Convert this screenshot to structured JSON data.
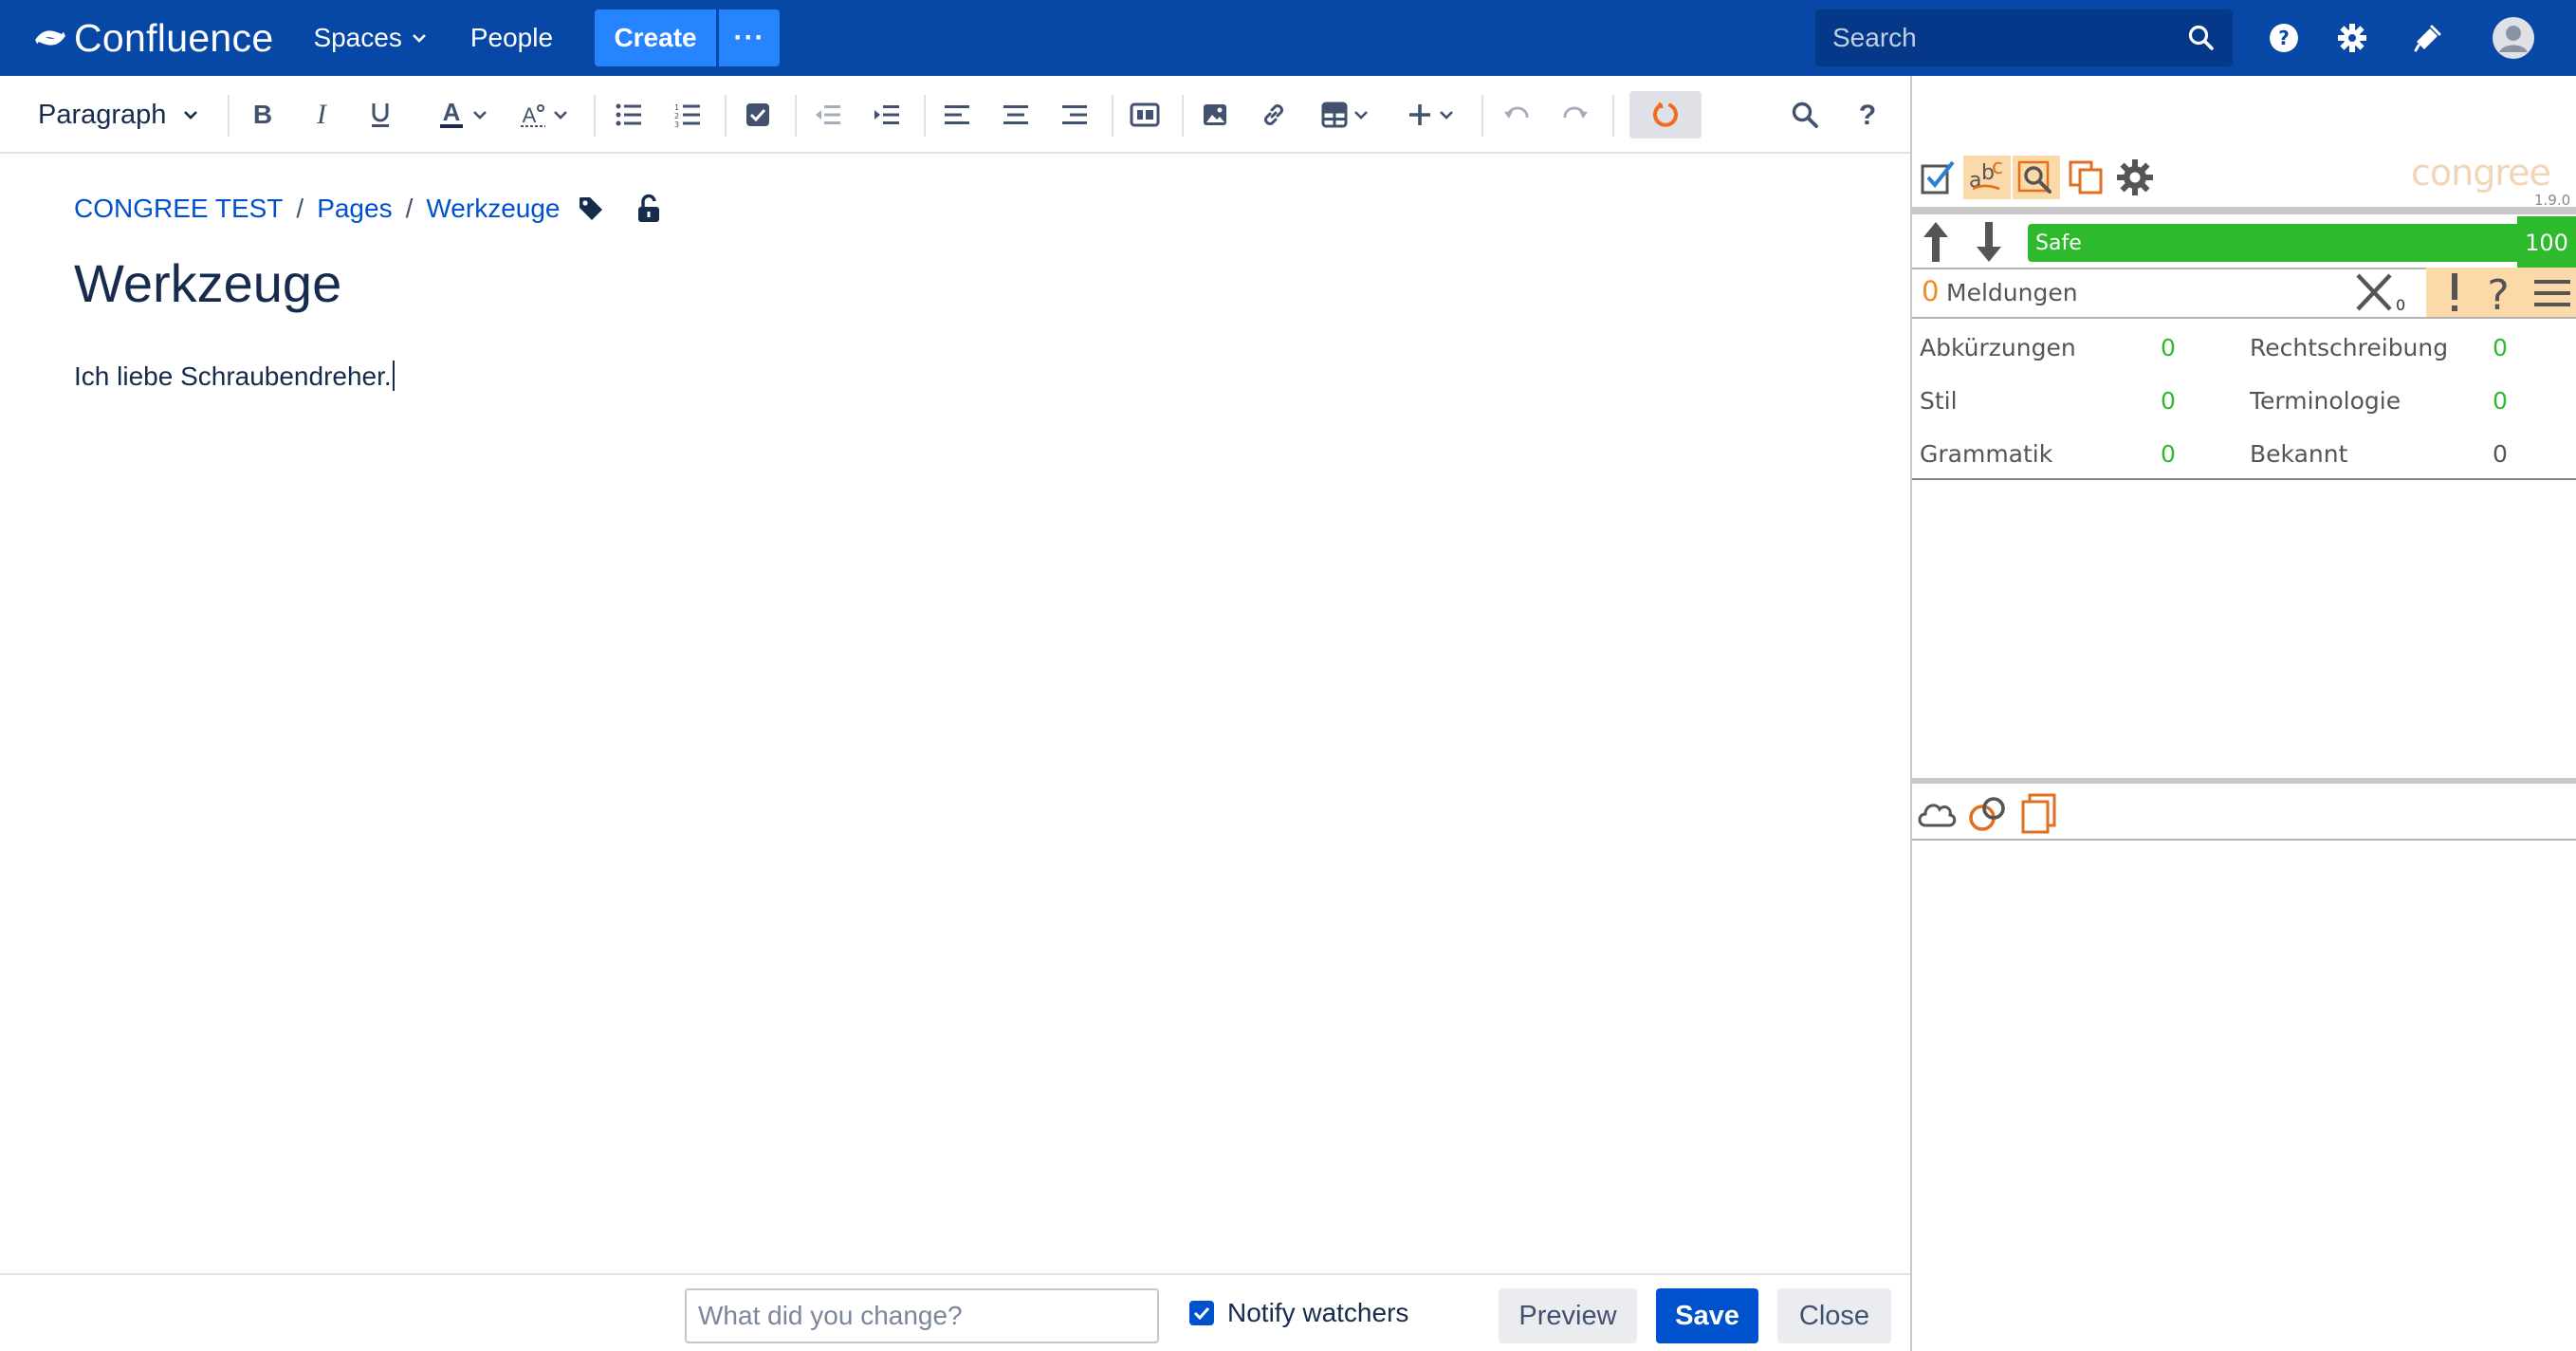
{
  "nav": {
    "logo_text": "Confluence",
    "spaces_label": "Spaces",
    "people_label": "People",
    "create_label": "Create",
    "more_label": "···",
    "search_placeholder": "Search",
    "brand_color": "#0747a6",
    "accent_color": "#2684ff"
  },
  "toolbar": {
    "style_select": "Paragraph",
    "icons": [
      "bold-icon",
      "italic-icon",
      "underline-icon",
      "text-color-icon",
      "text-style-icon",
      "bullet-list-icon",
      "numbered-list-icon",
      "task-list-icon",
      "outdent-icon",
      "indent-icon",
      "align-left-icon",
      "align-center-icon",
      "align-right-icon",
      "layout-icon",
      "image-icon",
      "link-icon",
      "table-icon",
      "insert-more-icon",
      "undo-icon",
      "redo-icon",
      "congree-refresh-icon",
      "find-replace-icon",
      "help-icon"
    ]
  },
  "editor": {
    "breadcrumb": [
      "CONGREE TEST",
      "Pages",
      "Werkzeuge"
    ],
    "title": "Werkzeuge",
    "body": "Ich liebe Schraubendreher."
  },
  "footer": {
    "change_placeholder": "What did you change?",
    "notify_label": "Notify watchers",
    "notify_checked": true,
    "preview_label": "Preview",
    "save_label": "Save",
    "close_label": "Close"
  },
  "congree": {
    "logo_text": "congree",
    "version": "1.9.0",
    "status_label": "Safe",
    "score": "100",
    "score_color": "#2dbb2d",
    "messages_count": "0",
    "messages_label": "Meldungen",
    "dismissed_count": "0",
    "stats": [
      {
        "label": "Abkürzungen",
        "value": "0"
      },
      {
        "label": "Rechtschreibung",
        "value": "0"
      },
      {
        "label": "Stil",
        "value": "0"
      },
      {
        "label": "Terminologie",
        "value": "0"
      },
      {
        "label": "Grammatik",
        "value": "0"
      },
      {
        "label": "Bekannt",
        "value": "0"
      }
    ]
  }
}
